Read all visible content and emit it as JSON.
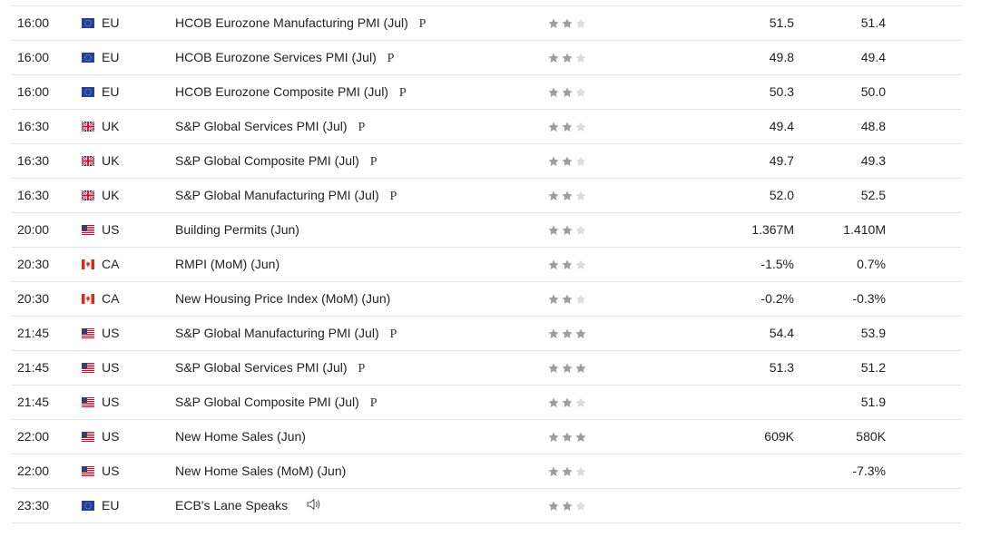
{
  "calendar": {
    "rows": [
      {
        "time": "16:00",
        "flag": "eu-flag-icon",
        "country": "EU",
        "event": "HCOB Eurozone Manufacturing PMI (Jul)",
        "prelim": "P",
        "speech": false,
        "importance": 2,
        "actual": "51.5",
        "forecast": "51.4"
      },
      {
        "time": "16:00",
        "flag": "eu-flag-icon",
        "country": "EU",
        "event": "HCOB Eurozone Services PMI (Jul)",
        "prelim": "P",
        "speech": false,
        "importance": 2,
        "actual": "49.8",
        "forecast": "49.4"
      },
      {
        "time": "16:00",
        "flag": "eu-flag-icon",
        "country": "EU",
        "event": "HCOB Eurozone Composite PMI (Jul)",
        "prelim": "P",
        "speech": false,
        "importance": 2,
        "actual": "50.3",
        "forecast": "50.0"
      },
      {
        "time": "16:30",
        "flag": "uk-flag-icon",
        "country": "UK",
        "event": "S&P Global Services PMI (Jul)",
        "prelim": "P",
        "speech": false,
        "importance": 2,
        "actual": "49.4",
        "forecast": "48.8"
      },
      {
        "time": "16:30",
        "flag": "uk-flag-icon",
        "country": "UK",
        "event": "S&P Global Composite PMI (Jul)",
        "prelim": "P",
        "speech": false,
        "importance": 2,
        "actual": "49.7",
        "forecast": "49.3"
      },
      {
        "time": "16:30",
        "flag": "uk-flag-icon",
        "country": "UK",
        "event": "S&P Global Manufacturing PMI (Jul)",
        "prelim": "P",
        "speech": false,
        "importance": 2,
        "actual": "52.0",
        "forecast": "52.5"
      },
      {
        "time": "20:00",
        "flag": "us-flag-icon",
        "country": "US",
        "event": "Building Permits (Jun)",
        "prelim": "",
        "speech": false,
        "importance": 2,
        "actual": "1.367M",
        "forecast": "1.410M"
      },
      {
        "time": "20:30",
        "flag": "ca-flag-icon",
        "country": "CA",
        "event": "RMPI (MoM) (Jun)",
        "prelim": "",
        "speech": false,
        "importance": 2,
        "actual": "-1.5%",
        "forecast": "0.7%"
      },
      {
        "time": "20:30",
        "flag": "ca-flag-icon",
        "country": "CA",
        "event": "New Housing Price Index (MoM) (Jun)",
        "prelim": "",
        "speech": false,
        "importance": 2,
        "actual": "-0.2%",
        "forecast": "-0.3%"
      },
      {
        "time": "21:45",
        "flag": "us-flag-icon",
        "country": "US",
        "event": "S&P Global Manufacturing PMI (Jul)",
        "prelim": "P",
        "speech": false,
        "importance": 3,
        "actual": "54.4",
        "forecast": "53.9"
      },
      {
        "time": "21:45",
        "flag": "us-flag-icon",
        "country": "US",
        "event": "S&P Global Services PMI (Jul)",
        "prelim": "P",
        "speech": false,
        "importance": 3,
        "actual": "51.3",
        "forecast": "51.2"
      },
      {
        "time": "21:45",
        "flag": "us-flag-icon",
        "country": "US",
        "event": "S&P Global Composite PMI (Jul)",
        "prelim": "P",
        "speech": false,
        "importance": 2,
        "actual": "",
        "forecast": "51.9"
      },
      {
        "time": "22:00",
        "flag": "us-flag-icon",
        "country": "US",
        "event": "New Home Sales (Jun)",
        "prelim": "",
        "speech": false,
        "importance": 3,
        "actual": "609K",
        "forecast": "580K"
      },
      {
        "time": "22:00",
        "flag": "us-flag-icon",
        "country": "US",
        "event": "New Home Sales (MoM) (Jun)",
        "prelim": "",
        "speech": false,
        "importance": 2,
        "actual": "",
        "forecast": "-7.3%"
      },
      {
        "time": "23:30",
        "flag": "eu-flag-icon",
        "country": "EU",
        "event": "ECB's Lane Speaks",
        "prelim": "",
        "speech": true,
        "importance": 2,
        "actual": "",
        "forecast": ""
      }
    ],
    "star_max": 3,
    "colors": {
      "star_filled": "#9e9e9e",
      "star_empty": "#dcdcdc",
      "divider": "#e6e6e6",
      "text": "#222222"
    }
  }
}
